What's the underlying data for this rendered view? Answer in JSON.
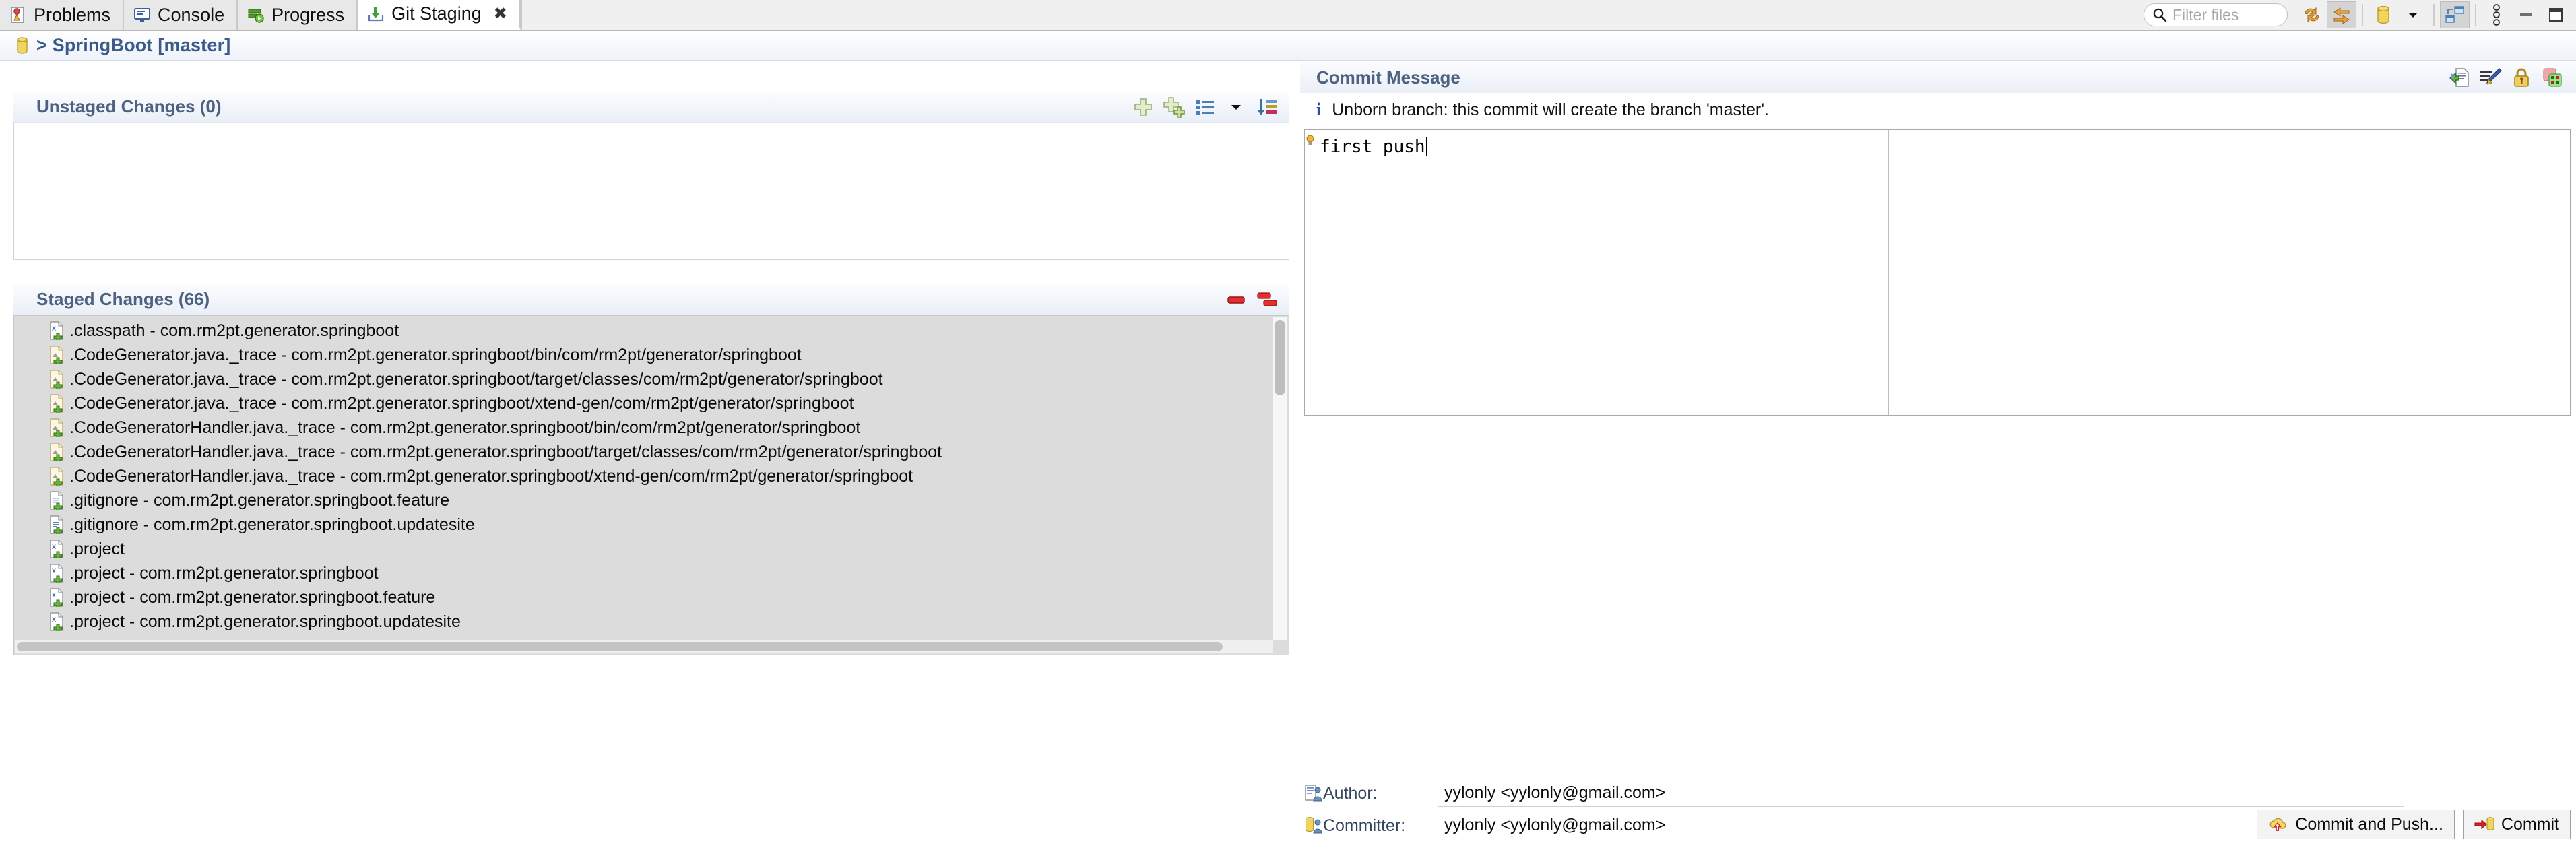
{
  "window": {
    "tabs": [
      {
        "label": "Problems",
        "icon": "problems-icon",
        "active": false
      },
      {
        "label": "Console",
        "icon": "console-icon",
        "active": false
      },
      {
        "label": "Progress",
        "icon": "progress-icon",
        "active": false
      },
      {
        "label": "Git Staging",
        "icon": "git-staging-icon",
        "active": true,
        "close": "✖"
      }
    ]
  },
  "toolbar": {
    "filter_placeholder": "Filter files",
    "filter_value": "",
    "search_icon": "search-icon",
    "buttons": [
      {
        "name": "refresh-icon",
        "title": "Refresh"
      },
      {
        "name": "compare-mode-icon",
        "title": "Compare Mode",
        "pressed": true
      },
      {
        "name": "repository-icon",
        "title": "Repository"
      },
      {
        "name": "dropdown-arrow-icon",
        "title": "Menu"
      },
      {
        "name": "presentation-icon",
        "title": "Presentation",
        "pressed": true
      },
      {
        "name": "view-menu-icon",
        "title": "View Menu"
      },
      {
        "name": "minimize-icon",
        "title": "Minimize"
      },
      {
        "name": "maximize-icon",
        "title": "Maximize"
      }
    ]
  },
  "breadcrumb": {
    "icon": "repository-icon",
    "text": "> SpringBoot [master]"
  },
  "unstaged": {
    "title": "Unstaged Changes (0)",
    "tools": [
      {
        "name": "stage-selected-icon",
        "title": "Add selected files to the index"
      },
      {
        "name": "stage-all-icon",
        "title": "Add all files to the index"
      },
      {
        "name": "list-presentation-icon",
        "title": "Presentation"
      },
      {
        "name": "presentation-dropdown-icon",
        "title": "Presentation menu"
      },
      {
        "name": "sort-icon",
        "title": "Sort"
      }
    ],
    "items": []
  },
  "staged": {
    "title": "Staged Changes (66)",
    "tools": [
      {
        "name": "unstage-selected-icon",
        "title": "Remove selected files from the index"
      },
      {
        "name": "unstage-all-icon",
        "title": "Remove all files from the index"
      }
    ],
    "items": [
      {
        "icon": "xml-file-added-icon",
        "label": ".classpath - com.rm2pt.generator.springboot"
      },
      {
        "icon": "file-added-icon",
        "label": ".CodeGenerator.java._trace - com.rm2pt.generator.springboot/bin/com/rm2pt/generator/springboot"
      },
      {
        "icon": "file-added-icon",
        "label": ".CodeGenerator.java._trace - com.rm2pt.generator.springboot/target/classes/com/rm2pt/generator/springboot"
      },
      {
        "icon": "file-added-icon",
        "label": ".CodeGenerator.java._trace - com.rm2pt.generator.springboot/xtend-gen/com/rm2pt/generator/springboot"
      },
      {
        "icon": "file-added-icon",
        "label": ".CodeGeneratorHandler.java._trace - com.rm2pt.generator.springboot/bin/com/rm2pt/generator/springboot"
      },
      {
        "icon": "file-added-icon",
        "label": ".CodeGeneratorHandler.java._trace - com.rm2pt.generator.springboot/target/classes/com/rm2pt/generator/springboot"
      },
      {
        "icon": "file-added-icon",
        "label": ".CodeGeneratorHandler.java._trace - com.rm2pt.generator.springboot/xtend-gen/com/rm2pt/generator/springboot"
      },
      {
        "icon": "text-file-added-icon",
        "label": ".gitignore - com.rm2pt.generator.springboot.feature"
      },
      {
        "icon": "text-file-added-icon",
        "label": ".gitignore - com.rm2pt.generator.springboot.updatesite"
      },
      {
        "icon": "xml-file-added-icon",
        "label": ".project"
      },
      {
        "icon": "xml-file-added-icon",
        "label": ".project - com.rm2pt.generator.springboot"
      },
      {
        "icon": "xml-file-added-icon",
        "label": ".project - com.rm2pt.generator.springboot.feature"
      },
      {
        "icon": "xml-file-added-icon",
        "label": ".project - com.rm2pt.generator.springboot.updatesite"
      }
    ]
  },
  "commit": {
    "title": "Commit Message",
    "tools": [
      {
        "name": "amend-commit-icon",
        "title": "Amend (Edit Previous Commit)"
      },
      {
        "name": "signed-off-by-icon",
        "title": "Add Signed-off-by"
      },
      {
        "name": "sign-commit-icon",
        "title": "Sign Commit"
      },
      {
        "name": "add-change-id-icon",
        "title": "Add Change-Id"
      }
    ],
    "notice": {
      "icon": "info-icon",
      "text": "Unborn branch: this commit will create the branch 'master'."
    },
    "message": "first push",
    "hint_icon": "lightbulb-icon",
    "author": {
      "icon": "author-icon",
      "label": "Author:",
      "value": "yylonly <yylonly@gmail.com>"
    },
    "committer": {
      "icon": "committer-icon",
      "label": "Committer:",
      "value": "yylonly <yylonly@gmail.com>"
    },
    "commit_and_push_label": "Commit and Push...",
    "commit_and_push_icon": "cloud-push-icon",
    "commit_label": "Commit",
    "commit_icon": "commit-arrow-icon"
  },
  "colors": {
    "accent_blue": "#3b5a8c",
    "header_text": "#4d6180",
    "added_green": "#4f9e29",
    "remove_red": "#d92b2b",
    "info_blue": "#2b4ea8",
    "gold": "#e8c44a"
  }
}
